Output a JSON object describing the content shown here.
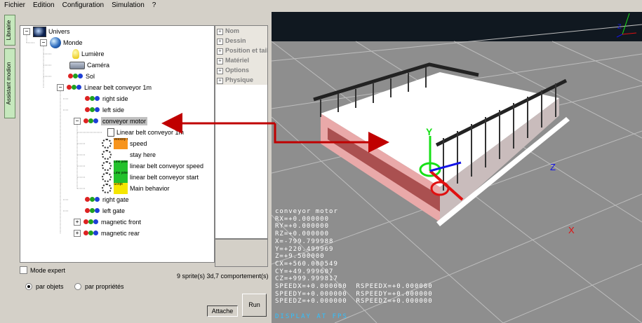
{
  "menu": [
    "Fichier",
    "Edition",
    "Configuration",
    "Simulation",
    "?"
  ],
  "side_tabs": [
    "Librairie",
    "Assistant modion"
  ],
  "tree": [
    {
      "label": "Univers",
      "icon": "univers-icon",
      "toggle": "−"
    },
    {
      "label": "Monde",
      "icon": "globe-icon",
      "toggle": "−"
    },
    {
      "label": "Lumière",
      "icon": "light-bulb-icon",
      "toggle": ""
    },
    {
      "label": "Caméra",
      "icon": "camera-icon",
      "toggle": ""
    },
    {
      "label": "Sol",
      "icon": "object-icon",
      "toggle": ""
    },
    {
      "label": "Linear belt conveyor 1m",
      "icon": "object-icon",
      "toggle": "−"
    },
    {
      "label": "right side",
      "icon": "object-icon",
      "toggle": ""
    },
    {
      "label": "left side",
      "icon": "object-icon",
      "toggle": ""
    },
    {
      "label": "conveyor motor",
      "icon": "object-icon",
      "toggle": "−"
    },
    {
      "label": "Linear belt conveyor 1m",
      "icon": "page-icon",
      "toggle": ""
    },
    {
      "label": "speed",
      "icon": "gear-icon",
      "toggle": "",
      "thumb": "Velocity relative",
      "thumb_color": "#f7941d"
    },
    {
      "label": "stay here",
      "icon": "gear-icon",
      "toggle": "",
      "thumb": "",
      "thumb_color": "#ffffff"
    },
    {
      "label": "linear belt conveyor speed",
      "icon": "gear-icon",
      "toggle": "",
      "thumb": "Link (linear)",
      "thumb_color": "#22c12b"
    },
    {
      "label": "linear belt conveyor start",
      "icon": "gear-icon",
      "toggle": "",
      "thumb": "Link (linear)",
      "thumb_color": "#22c12b"
    },
    {
      "label": "Main behavior",
      "icon": "gear-icon",
      "toggle": "",
      "thumb": "Script",
      "thumb_color": "#f5e600"
    },
    {
      "label": "right gate",
      "icon": "object-icon",
      "toggle": ""
    },
    {
      "label": "left gate",
      "icon": "object-icon",
      "toggle": ""
    },
    {
      "label": "magnetic front",
      "icon": "object-icon",
      "toggle": "+"
    },
    {
      "label": "magnetic rear",
      "icon": "object-icon",
      "toggle": "+"
    }
  ],
  "properties": [
    "Nom",
    "Dessin",
    "Position et taille",
    "Matériel",
    "Options",
    "Physique"
  ],
  "count_text": "9 sprite(s) 3d,7 comportement(s)",
  "mode_expert": "Mode expert",
  "radio_objects": "par objets",
  "radio_props": "par propriétés",
  "btn_attache": "Attache",
  "btn_run": "Run",
  "viewport": {
    "overlay": [
      "conveyor motor",
      "RX=+0.000000",
      "RY=+0.000000",
      "RZ=+0.000000",
      "X=-799.799988",
      "Y=+220.499969",
      "Z=+9.500000",
      "CX=+560.000549",
      "CY=+49.999607",
      "CZ=+999.999817",
      "SPEEDX=+0.000000  RSPEEDX=+0.000000",
      "SPEEDY=+0.000000  RSPEEDY=+0.000000",
      "SPEEDZ=+0.000000  RSPEEDZ=+0.000000"
    ],
    "fps": "DISPLAY AT FPS",
    "axis_y": "Y",
    "axis_z": "Z",
    "axis_x": "X",
    "mini_z": "Z"
  },
  "colors": {
    "arrow": "#c00000",
    "axis_green": "#17e017",
    "axis_blue": "#1414e6",
    "axis_red": "#e01010"
  }
}
